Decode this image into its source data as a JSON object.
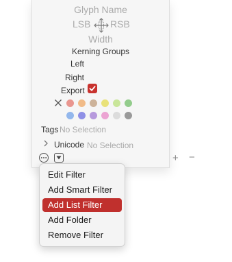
{
  "panel": {
    "glyph_name_placeholder": "Glyph Name",
    "lsb_label": "LSB",
    "rsb_label": "RSB",
    "width_label": "Width",
    "kerning_groups_label": "Kerning Groups",
    "left_label": "Left",
    "right_label": "Right",
    "export_label": "Export",
    "export_checked": true,
    "color_labels": {
      "row1": [
        "#e9968f",
        "#f1bb88",
        "#cdb39a",
        "#e9e27a",
        "#c9e69a",
        "#93cc8c"
      ],
      "row2": [
        "#93b7ec",
        "#8f90e6",
        "#b79add",
        "#eca4d3",
        "#dcdcdc",
        "#9a9a9a"
      ]
    },
    "tags_label": "Tags",
    "tags_value": "No Selection",
    "unicode_label": "Unicode",
    "unicode_value": "No Selection"
  },
  "bottom_bar": {
    "plus_label": "+",
    "minus_label": "−"
  },
  "menu": {
    "items": [
      {
        "label": "Edit Filter",
        "active": false
      },
      {
        "label": "Add Smart Filter",
        "active": false
      },
      {
        "label": "Add List Filter",
        "active": true
      },
      {
        "label": "Add Folder",
        "active": false
      },
      {
        "label": "Remove Filter",
        "active": false
      }
    ]
  },
  "colors": {
    "accent": "#c8322e",
    "menu_highlight": "#c0302d"
  }
}
